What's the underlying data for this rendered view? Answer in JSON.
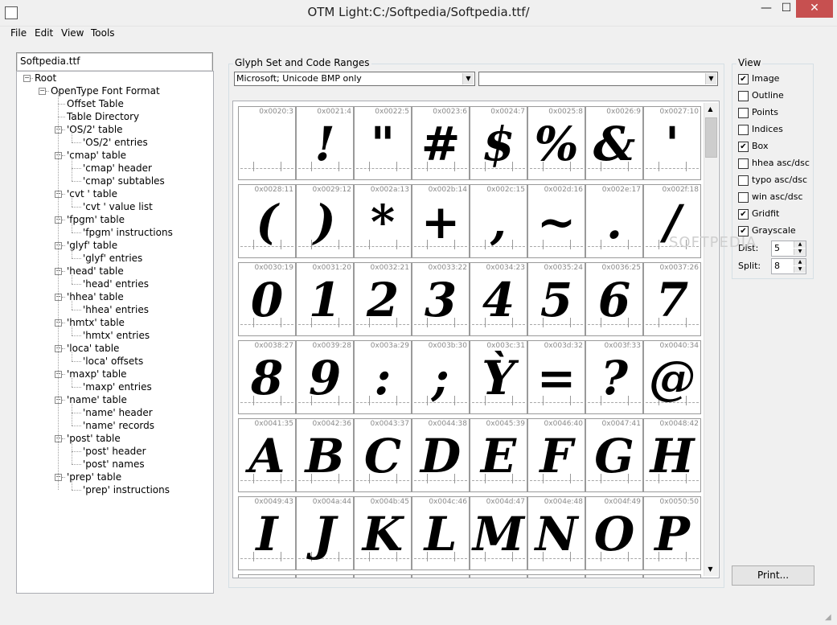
{
  "window": {
    "title": "OTM Light:C:/Softpedia/Softpedia.ttf/",
    "min_label": "—",
    "max_label": "☐",
    "close_label": "✕"
  },
  "menu": [
    "File",
    "Edit",
    "View",
    "Tools"
  ],
  "tree": {
    "header": "Softpedia.ttf",
    "nodes": [
      {
        "label": "Root",
        "level": 0,
        "expander": "−"
      },
      {
        "label": "OpenType Font Format",
        "level": 1,
        "expander": "−"
      },
      {
        "label": "Offset Table",
        "level": 2,
        "expander": ""
      },
      {
        "label": "Table Directory",
        "level": 2,
        "expander": ""
      },
      {
        "label": "'OS/2' table",
        "level": 2,
        "expander": "−"
      },
      {
        "label": "'OS/2' entries",
        "level": 3,
        "expander": ""
      },
      {
        "label": "'cmap' table",
        "level": 2,
        "expander": "−"
      },
      {
        "label": "'cmap' header",
        "level": 3,
        "expander": ""
      },
      {
        "label": "'cmap' subtables",
        "level": 3,
        "expander": ""
      },
      {
        "label": "'cvt ' table",
        "level": 2,
        "expander": "−"
      },
      {
        "label": "'cvt ' value list",
        "level": 3,
        "expander": ""
      },
      {
        "label": "'fpgm' table",
        "level": 2,
        "expander": "−"
      },
      {
        "label": "'fpgm' instructions",
        "level": 3,
        "expander": ""
      },
      {
        "label": "'glyf' table",
        "level": 2,
        "expander": "−"
      },
      {
        "label": "'glyf' entries",
        "level": 3,
        "expander": ""
      },
      {
        "label": "'head' table",
        "level": 2,
        "expander": "−"
      },
      {
        "label": "'head' entries",
        "level": 3,
        "expander": ""
      },
      {
        "label": "'hhea' table",
        "level": 2,
        "expander": "−"
      },
      {
        "label": "'hhea' entries",
        "level": 3,
        "expander": ""
      },
      {
        "label": "'hmtx' table",
        "level": 2,
        "expander": "−"
      },
      {
        "label": "'hmtx' entries",
        "level": 3,
        "expander": ""
      },
      {
        "label": "'loca' table",
        "level": 2,
        "expander": "−"
      },
      {
        "label": "'loca' offsets",
        "level": 3,
        "expander": ""
      },
      {
        "label": "'maxp' table",
        "level": 2,
        "expander": "−"
      },
      {
        "label": "'maxp' entries",
        "level": 3,
        "expander": ""
      },
      {
        "label": "'name' table",
        "level": 2,
        "expander": "−"
      },
      {
        "label": "'name' header",
        "level": 3,
        "expander": ""
      },
      {
        "label": "'name' records",
        "level": 3,
        "expander": ""
      },
      {
        "label": "'post' table",
        "level": 2,
        "expander": "−"
      },
      {
        "label": "'post' header",
        "level": 3,
        "expander": ""
      },
      {
        "label": "'post' names",
        "level": 3,
        "expander": ""
      },
      {
        "label": "'prep' table",
        "level": 2,
        "expander": "−"
      },
      {
        "label": "'prep' instructions",
        "level": 3,
        "expander": ""
      }
    ]
  },
  "glyph_set": {
    "label": "Glyph Set and Code Ranges",
    "encoding": "Microsoft; Unicode BMP only",
    "range": "",
    "glyphs": [
      {
        "code": "0x0020:3",
        "char": ""
      },
      {
        "code": "0x0021:4",
        "char": "!"
      },
      {
        "code": "0x0022:5",
        "char": "\""
      },
      {
        "code": "0x0023:6",
        "char": "#"
      },
      {
        "code": "0x0024:7",
        "char": "$"
      },
      {
        "code": "0x0025:8",
        "char": "%"
      },
      {
        "code": "0x0026:9",
        "char": "&"
      },
      {
        "code": "0x0027:10",
        "char": "'"
      },
      {
        "code": "0x0028:11",
        "char": "("
      },
      {
        "code": "0x0029:12",
        "char": ")"
      },
      {
        "code": "0x002a:13",
        "char": "*"
      },
      {
        "code": "0x002b:14",
        "char": "+"
      },
      {
        "code": "0x002c:15",
        "char": ","
      },
      {
        "code": "0x002d:16",
        "char": "~"
      },
      {
        "code": "0x002e:17",
        "char": "."
      },
      {
        "code": "0x002f:18",
        "char": "/"
      },
      {
        "code": "0x0030:19",
        "char": "0"
      },
      {
        "code": "0x0031:20",
        "char": "1"
      },
      {
        "code": "0x0032:21",
        "char": "2"
      },
      {
        "code": "0x0033:22",
        "char": "3"
      },
      {
        "code": "0x0034:23",
        "char": "4"
      },
      {
        "code": "0x0035:24",
        "char": "5"
      },
      {
        "code": "0x0036:25",
        "char": "6"
      },
      {
        "code": "0x0037:26",
        "char": "7"
      },
      {
        "code": "0x0038:27",
        "char": "8"
      },
      {
        "code": "0x0039:28",
        "char": "9"
      },
      {
        "code": "0x003a:29",
        "char": ":"
      },
      {
        "code": "0x003b:30",
        "char": ";"
      },
      {
        "code": "0x003c:31",
        "char": "Ỳ"
      },
      {
        "code": "0x003d:32",
        "char": "="
      },
      {
        "code": "0x003f:33",
        "char": "?"
      },
      {
        "code": "0x0040:34",
        "char": "@"
      },
      {
        "code": "0x0041:35",
        "char": "A"
      },
      {
        "code": "0x0042:36",
        "char": "B"
      },
      {
        "code": "0x0043:37",
        "char": "C"
      },
      {
        "code": "0x0044:38",
        "char": "D"
      },
      {
        "code": "0x0045:39",
        "char": "E"
      },
      {
        "code": "0x0046:40",
        "char": "F"
      },
      {
        "code": "0x0047:41",
        "char": "G"
      },
      {
        "code": "0x0048:42",
        "char": "H"
      },
      {
        "code": "0x0049:43",
        "char": "I"
      },
      {
        "code": "0x004a:44",
        "char": "J"
      },
      {
        "code": "0x004b:45",
        "char": "K"
      },
      {
        "code": "0x004c:46",
        "char": "L"
      },
      {
        "code": "0x004d:47",
        "char": "M"
      },
      {
        "code": "0x004e:48",
        "char": "N"
      },
      {
        "code": "0x004f:49",
        "char": "O"
      },
      {
        "code": "0x0050:50",
        "char": "P"
      }
    ]
  },
  "view": {
    "label": "View",
    "options": [
      {
        "label": "Image",
        "checked": true
      },
      {
        "label": "Outline",
        "checked": false
      },
      {
        "label": "Points",
        "checked": false
      },
      {
        "label": "Indices",
        "checked": false
      },
      {
        "label": "Box",
        "checked": true
      },
      {
        "label": "hhea asc/dsc",
        "checked": false
      },
      {
        "label": "typo asc/dsc",
        "checked": false
      },
      {
        "label": "win asc/dsc",
        "checked": false
      },
      {
        "label": "Gridfit",
        "checked": true
      },
      {
        "label": "Grayscale",
        "checked": true
      }
    ],
    "dist_label": "Dist:",
    "dist_value": "5",
    "split_label": "Split:",
    "split_value": "8"
  },
  "print_label": "Print...",
  "watermark": "SOFTPEDIA"
}
